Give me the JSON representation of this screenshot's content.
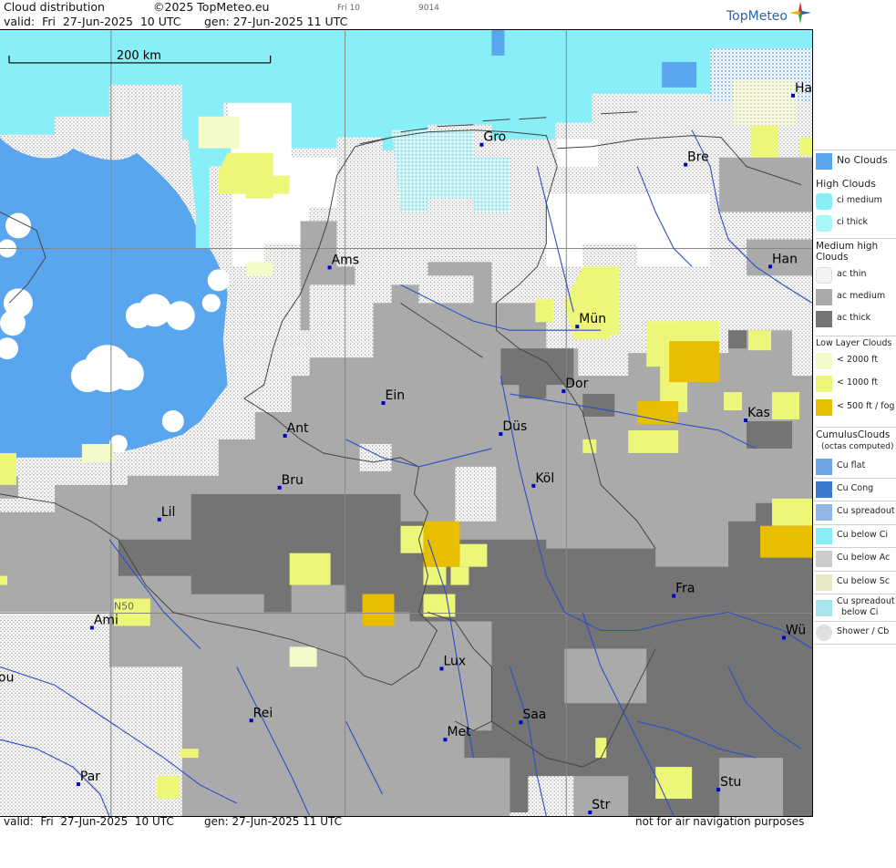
{
  "header": {
    "product": "Cloud distribution",
    "copyright": "©2025 TopMeteo.eu",
    "small_day": "Fri 10",
    "small_code": "9014",
    "valid": "valid:  Fri  27-Jun-2025  10 UTC",
    "gen": "gen: 27-Jun-2025 11 UTC",
    "logo": "TopMeteo"
  },
  "map": {
    "scale_label": "200 km",
    "latitude_label": "N50",
    "colors": {
      "no_clouds": "#5aa6ee",
      "ci_medium": "#88eef8",
      "ci_thick": "#aaf6fa",
      "ac_thin": "#ffffff",
      "ac_medium": "#aaaaaa",
      "ac_thick": "#747474",
      "low_2000": "#f4fbc8",
      "low_1000": "#eef67a",
      "low_500": "#e9bd00",
      "cu_dots": "#9a9a9a",
      "borders": "#555555",
      "rivers": "#2a4fc8",
      "city_marker": "#0000cc"
    },
    "cities": [
      {
        "name": "Gro"
      },
      {
        "name": "Bre"
      },
      {
        "name": "Ha"
      },
      {
        "name": "Ams"
      },
      {
        "name": "Han"
      },
      {
        "name": "Mün"
      },
      {
        "name": "Dor"
      },
      {
        "name": "Ein"
      },
      {
        "name": "Ant"
      },
      {
        "name": "Düs"
      },
      {
        "name": "Kas"
      },
      {
        "name": "Bru"
      },
      {
        "name": "Köl"
      },
      {
        "name": "Lil"
      },
      {
        "name": "Fra"
      },
      {
        "name": "Ami"
      },
      {
        "name": "Lux"
      },
      {
        "name": "Wü"
      },
      {
        "name": "Rei"
      },
      {
        "name": "Saa"
      },
      {
        "name": "Met"
      },
      {
        "name": "Par"
      },
      {
        "name": "Stu"
      },
      {
        "name": "Str"
      },
      {
        "name": "ou"
      }
    ]
  },
  "footer": {
    "valid": "valid:  Fri  27-Jun-2025  10 UTC",
    "gen": "gen: 27-Jun-2025 11 UTC",
    "disclaimer": "not for air navigation purposes"
  },
  "legend": {
    "no_clouds": "No Clouds",
    "high_title": "High Clouds",
    "ci_medium": "ci medium",
    "ci_thick": "ci thick",
    "medium_title_1": "Medium high",
    "medium_title_2": "Clouds",
    "ac_thin": "ac thin",
    "ac_medium": "ac medium",
    "ac_thick": "ac thick",
    "low_title": "Low Layer Clouds",
    "low_2000": "< 2000 ft",
    "low_1000": "< 1000 ft",
    "low_500": "< 500 ft / fog",
    "cumulus_title": "CumulusClouds",
    "cumulus_sub": "(octas computed)",
    "cu_flat": "Cu flat",
    "cu_cong": "Cu Cong",
    "cu_spreadout": "Cu spreadout",
    "cu_below_ci": "Cu below Ci",
    "cu_below_ac": "Cu below Ac",
    "cu_below_sc": "Cu below Sc",
    "cu_spreadout_below_ci_1": "Cu spreadout",
    "cu_spreadout_below_ci_2": "below Ci",
    "shower_cb": "Shower / Cb"
  }
}
